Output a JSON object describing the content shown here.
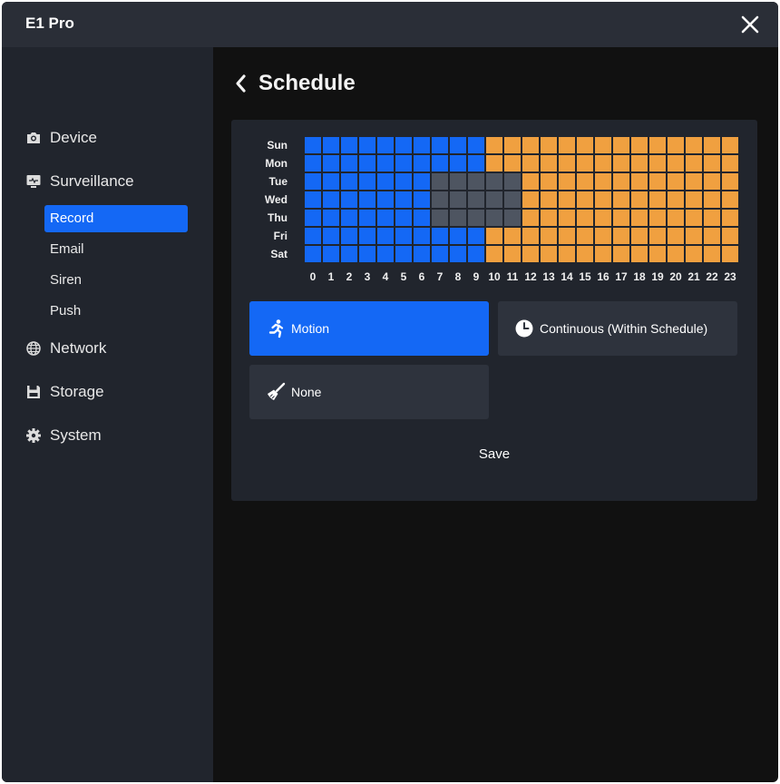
{
  "app": {
    "title": "E1 Pro"
  },
  "sidebar": {
    "device": "Device",
    "surveillance": "Surveillance",
    "record": "Record",
    "email": "Email",
    "siren": "Siren",
    "push": "Push",
    "network": "Network",
    "storage": "Storage",
    "system": "System"
  },
  "schedule": {
    "title": "Schedule",
    "days": [
      "Sun",
      "Mon",
      "Tue",
      "Wed",
      "Thu",
      "Fri",
      "Sat"
    ],
    "hours": [
      "0",
      "1",
      "2",
      "3",
      "4",
      "5",
      "6",
      "7",
      "8",
      "9",
      "10",
      "11",
      "12",
      "13",
      "14",
      "15",
      "16",
      "17",
      "18",
      "19",
      "20",
      "21",
      "22",
      "23"
    ],
    "grid_legend": {
      "M": "Motion",
      "C": "Continuous",
      "N": "None"
    },
    "grid": [
      "MMMMMMMMMMCCCCCCCCCCCCCC",
      "MMMMMMMMMMCCCCCCCCCCCCCC",
      "MMMMMMMNNNNNCCCCCCCCCCCC",
      "MMMMMMMNNNNNCCCCCCCCCCCC",
      "MMMMMMMNNNNNCCCCCCCCCCCC",
      "MMMMMMMMMMCCCCCCCCCCCCCC",
      "MMMMMMMMMMCCCCCCCCCCCCCC"
    ]
  },
  "modes": {
    "motion": "Motion",
    "continuous": "Continuous (Within Schedule)",
    "none": "None",
    "selected": "motion"
  },
  "colors": {
    "motion": "#1468f5",
    "continuous": "#f0a040",
    "none": "#4e5561",
    "active_button": "#1468f5",
    "inactive_button": "#2e333d"
  },
  "actions": {
    "save": "Save"
  },
  "icons": {
    "close": "close-icon",
    "back": "chevron-left-icon",
    "device": "camera-icon",
    "surveillance": "monitor-icon",
    "network": "globe-icon",
    "storage": "floppy-icon",
    "system": "gear-icon",
    "motion": "running-person-icon",
    "continuous": "clock-icon",
    "none": "broom-icon"
  }
}
